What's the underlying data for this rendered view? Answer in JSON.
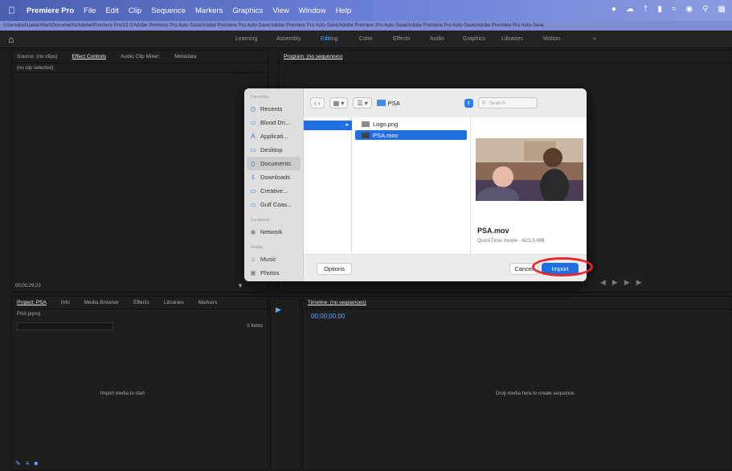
{
  "menubar": {
    "app": "Premiere Pro",
    "items": [
      "File",
      "Edit",
      "Clip",
      "Sequence",
      "Markers",
      "Graphics",
      "View",
      "Window",
      "Help"
    ]
  },
  "path": "/Users/joshuaearnhart/Documents/Adobe/Premiere Pro/13.0/Adobe Premiere Pro Auto-Save/Adobe Premiere Pro Auto-Save/Adobe Premiere Pro Auto-Save/Adobe Premiere Pro Auto-Save/Adobe Premiere Pro Auto-Save/Adobe Premiere Pro Auto-Save",
  "workspaces": [
    "Learning",
    "Assembly",
    "Editing",
    "Color",
    "Effects",
    "Audio",
    "Graphics",
    "Libraries",
    "Motion"
  ],
  "source_panel": {
    "tabs": [
      "Source: (no clips)",
      "Effect Controls",
      "Audio Clip Mixer:",
      "Metadata"
    ],
    "status": "(no clip selected)",
    "timecode": "00;00;29;23"
  },
  "program_panel": {
    "title": "Program: (no sequences)"
  },
  "project_panel": {
    "tabs": [
      "Project: PSA",
      "Info",
      "Media Browser",
      "Effects",
      "Libraries",
      "Markers"
    ],
    "file": "PSA.prproj",
    "items_count": "0 Items",
    "empty": "Import media to start"
  },
  "timeline_panel": {
    "title": "Timeline: (no sequences)",
    "timecode": "00;00;00;00",
    "empty": "Drop media here to create sequence."
  },
  "dialog": {
    "sidebar": {
      "favorites_heading": "Favorites",
      "favorites": [
        "Recents",
        "Blood Dri...",
        "Applicati...",
        "Desktop",
        "Documents",
        "Downloads",
        "Creative...",
        "Gulf Coas..."
      ],
      "locations_heading": "Locations",
      "locations": [
        "Network"
      ],
      "media_heading": "Media",
      "media": [
        "Music",
        "Photos"
      ]
    },
    "folder": "PSA",
    "search_placeholder": "Search",
    "files": [
      "Logo.png",
      "PSA.mov"
    ],
    "preview": {
      "name": "PSA.mov",
      "info": "QuickTime movie - 623.5 MB"
    },
    "options": "Options",
    "cancel": "Cancel",
    "import": "Import"
  }
}
